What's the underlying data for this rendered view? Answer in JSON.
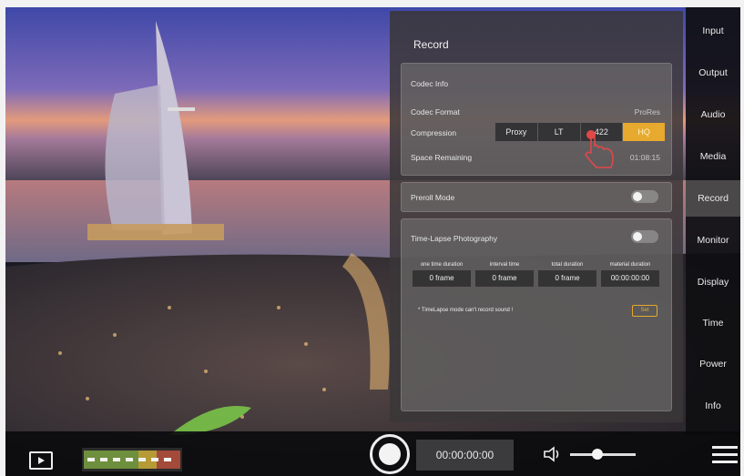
{
  "panel": {
    "title": "Record",
    "codec": {
      "section_title": "Codec Info",
      "format_label": "Codec Format",
      "format_value": "ProRes",
      "compression_label": "Compression",
      "compression_options": [
        "Proxy",
        "LT",
        "422",
        "HQ"
      ],
      "compression_selected": "HQ",
      "space_label": "Space Remaining",
      "space_value": "01:08:15"
    },
    "preroll": {
      "label": "Preroll Mode",
      "enabled": false
    },
    "timelapse": {
      "label": "Time-Lapse Photography",
      "enabled": false,
      "columns": [
        "one time duration",
        "interval time",
        "total duration",
        "material duration"
      ],
      "values": [
        "0 frame",
        "0 frame",
        "0 frame",
        "00:00:00:00"
      ],
      "note": "* TimeLapse mode can't record sound !",
      "set_button": "Set"
    }
  },
  "sidebar": {
    "items": [
      "Input",
      "Output",
      "Audio",
      "Media",
      "Record",
      "Monitor",
      "Display",
      "Time",
      "Power",
      "Info"
    ],
    "active": "Record"
  },
  "bottombar": {
    "timecode": "00:00:00:00",
    "volume_level": 0.35
  },
  "colors": {
    "accent": "#e7a92e",
    "panel_bg": "#3a3738",
    "sidebar_bg": "#0f0f12"
  }
}
